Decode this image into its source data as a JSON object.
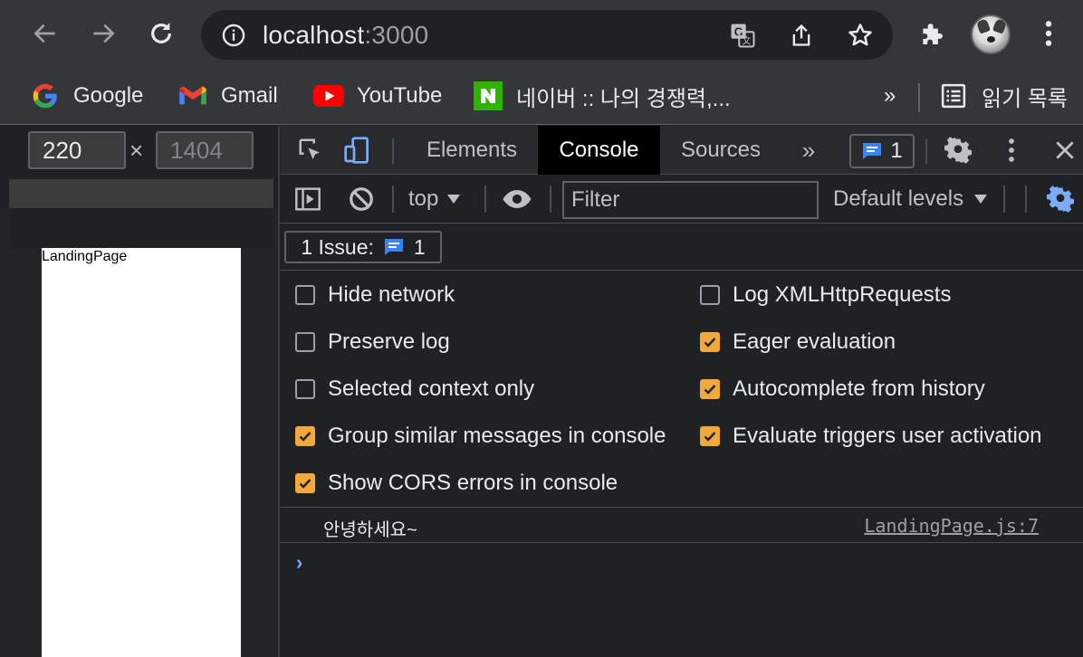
{
  "browser": {
    "address": {
      "host": "localhost",
      "port": ":3000"
    },
    "icons": {
      "back": "back-arrow-icon",
      "forward": "forward-arrow-icon",
      "reload": "reload-icon",
      "info": "info-icon",
      "translate": "translate-icon",
      "share": "share-icon",
      "bookmark": "star-icon",
      "extensions": "puzzle-icon",
      "menu": "kebab-menu-icon"
    }
  },
  "bookmarks": {
    "items": [
      {
        "label": "Google",
        "icon": "google-icon"
      },
      {
        "label": "Gmail",
        "icon": "gmail-icon"
      },
      {
        "label": "YouTube",
        "icon": "youtube-icon"
      },
      {
        "label": "네이버 :: 나의 경쟁력,...",
        "icon": "naver-icon"
      }
    ],
    "overflow": "»",
    "reading_list": "읽기 목록"
  },
  "device_toolbar": {
    "width": "220",
    "height_placeholder": "1404",
    "times": "×"
  },
  "page": {
    "text": "LandingPage"
  },
  "devtools": {
    "tabs": [
      "Elements",
      "Console",
      "Sources"
    ],
    "active_tab": "Console",
    "more_tabs": "»",
    "issue_count": "1",
    "context": "top",
    "filter_placeholder": "Filter",
    "levels": "Default levels",
    "issues_label": "1 Issue:",
    "issues_count": "1",
    "settings_left": [
      {
        "label": "Hide network",
        "checked": false
      },
      {
        "label": "Preserve log",
        "checked": false
      },
      {
        "label": "Selected context only",
        "checked": false
      },
      {
        "label": "Group similar messages in console",
        "checked": true
      },
      {
        "label": "Show CORS errors in console",
        "checked": true
      }
    ],
    "settings_right": [
      {
        "label": "Log XMLHttpRequests",
        "checked": false
      },
      {
        "label": "Eager evaluation",
        "checked": true
      },
      {
        "label": "Autocomplete from history",
        "checked": true
      },
      {
        "label": "Evaluate triggers user activation",
        "checked": true
      }
    ],
    "message": {
      "text": "안녕하세요~",
      "source": "LandingPage.js:7"
    },
    "prompt": "›",
    "accent_color": "#f2a93b"
  }
}
